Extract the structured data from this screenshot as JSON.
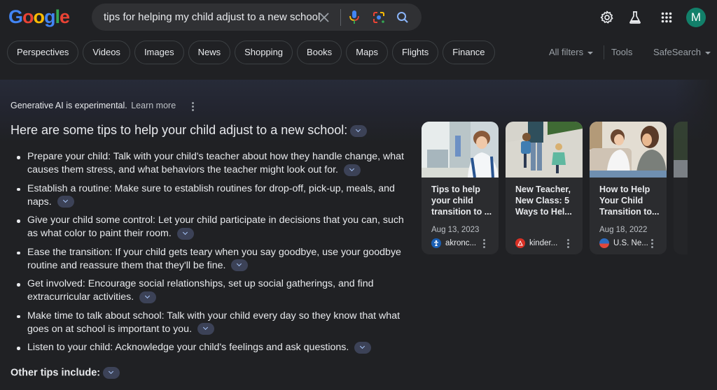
{
  "header": {
    "logo_letters": [
      {
        "ch": "G",
        "color": "#4285f4"
      },
      {
        "ch": "o",
        "color": "#ea4335"
      },
      {
        "ch": "o",
        "color": "#fbbc05"
      },
      {
        "ch": "g",
        "color": "#4285f4"
      },
      {
        "ch": "l",
        "color": "#34a853"
      },
      {
        "ch": "e",
        "color": "#ea4335"
      }
    ],
    "search_query": "tips for helping my child adjust to a new school",
    "avatar_initial": "M",
    "icons": [
      "clear-icon",
      "microphone-icon",
      "google-lens-icon",
      "search-icon",
      "gear-icon",
      "labs-flask-icon",
      "apps-grid-icon"
    ]
  },
  "chips": [
    "Perspectives",
    "Videos",
    "Images",
    "News",
    "Shopping",
    "Books",
    "Maps",
    "Flights",
    "Finance"
  ],
  "filters": {
    "all_filters": "All filters",
    "tools": "Tools",
    "safesearch": "SafeSearch"
  },
  "ai_overview": {
    "notice": "Generative AI is experimental.",
    "learn_more": "Learn more",
    "title": "Here are some tips to help your child adjust to a new school:",
    "tips": [
      "Prepare your child: Talk with your child's teacher about how they handle change, what causes them stress, and what behaviors the teacher might look out for.",
      "Establish a routine: Make sure to establish routines for drop-off, pick-up, meals, and naps.",
      "Give your child some control: Let your child participate in decisions that you can, such as what color to paint their room.",
      "Ease the transition: If your child gets teary when you say goodbye, use your goodbye routine and reassure them that they'll be fine.",
      "Get involved: Encourage social relationships, set up social gatherings, and find extracurricular activities.",
      "Make time to talk about school: Talk with your child every day so they know that what goes on at school is important to you.",
      "Listen to your child: Acknowledge your child's feelings and ask questions."
    ],
    "other_tips": "Other tips include:"
  },
  "cards": [
    {
      "title": "Tips to help your child transition to ...",
      "date": "Aug 13, 2023",
      "source": "akronc...",
      "favicon_color": "#1a5fb4"
    },
    {
      "title": "New Teacher, New Class: 5 Ways to Hel...",
      "date": "",
      "source": "kinder...",
      "favicon_color": "#d93025"
    },
    {
      "title": "How to Help Your Child Transition to...",
      "date": "Aug 18, 2022",
      "source": "U.S. Ne...",
      "favicon_color": "#2d6cc0"
    }
  ]
}
